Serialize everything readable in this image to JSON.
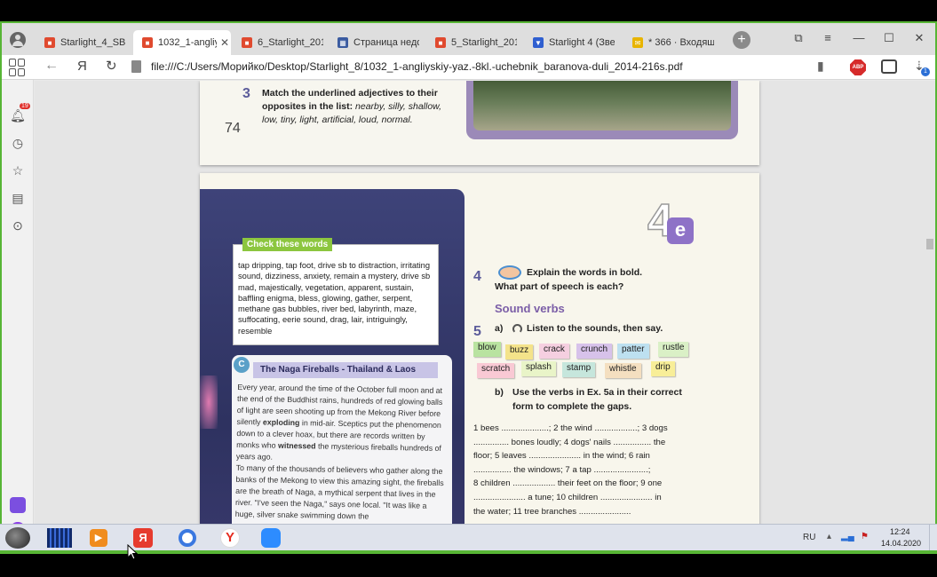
{
  "tabs": [
    {
      "label": "Starlight_4_SB.p",
      "icon": "pdf-icon",
      "active": false
    },
    {
      "label": "1032_1-angliy",
      "icon": "pdf-icon",
      "active": true
    },
    {
      "label": "6_Starlight_2013",
      "icon": "pdf-icon",
      "active": false
    },
    {
      "label": "Страница недос",
      "icon": "page-icon",
      "active": false
    },
    {
      "label": "5_Starlight_2012",
      "icon": "pdf-icon",
      "active": false
    },
    {
      "label": "Starlight 4 (Звез",
      "icon": "bookmark-icon",
      "active": false
    },
    {
      "label": "* 366 · Входящи",
      "icon": "mail-icon",
      "active": false
    }
  ],
  "address": {
    "url": "file:///C:/Users/Морийко/Desktop/Starlight_8/1032_1-angliyskiy-yaz.-8kl.-uchebnik_baranova-duli_2014-216s.pdf",
    "yandex_label": "Я"
  },
  "sidebar": {
    "notification_count": "19"
  },
  "extensions": {
    "abp": "ABP",
    "download_badge": "1"
  },
  "page74": {
    "exercise_number": "3",
    "instruction_bold": "Match the underlined adjectives to their opposites in the list:",
    "list_items": "nearby, silly, shallow, low, tiny, light, artificial, loud, normal.",
    "page_number": "74"
  },
  "page75": {
    "badge_number": "4",
    "badge_letter": "e",
    "check_words_title": "Check these words",
    "check_words_text": "tap dripping, tap foot, drive sb to distraction, irritating sound, dizziness, anxiety, remain a mystery, drive sb mad, majestically, vegetation, apparent, sustain, baffling enigma, bless, glowing, gather, serpent, methane gas bubbles, river bed, labyrinth, maze, suffocating, eerie sound, drag, lair, intriguingly, resemble",
    "reading_letter": "C",
    "reading_title": "The Naga Fireballs - Thailand & Laos",
    "reading_p1_a": "Every year, around the time of the October full moon and at the end of the Buddhist rains, hundreds of red glowing balls of light are seen shooting up from the Mekong River before silently",
    "reading_p1_bold1": "exploding",
    "reading_p1_b": "in mid-air. Sceptics put the phenomenon down to a clever hoax, but there are records written by monks who",
    "reading_p1_bold2": "witnessed",
    "reading_p1_c": "the mysterious fireballs hundreds of years ago.",
    "reading_p2": "To many of the thousands of believers who gather along the banks of the Mekong to view this amazing sight, the fireballs are the breath of Naga, a mythical serpent that lives in the river. \"I've seen the Naga,\" says one local. \"It was like a huge, silver snake swimming down the",
    "ex4_number": "4",
    "ex4_line1": "Explain the words in bold.",
    "ex4_line2": "What part of speech is each?",
    "section_title": "Sound verbs",
    "ex5_number": "5",
    "ex5a_label": "a)",
    "ex5a_text": "Listen to the sounds, then say.",
    "chips_row1": [
      "blow",
      "buzz",
      "crack",
      "crunch",
      "patter",
      "rustle"
    ],
    "chips_row2": [
      "scratch",
      "splash",
      "stamp",
      "whistle",
      "drip"
    ],
    "ex5b_label": "b)",
    "ex5b_line1": "Use the verbs in Ex. 5a in their correct",
    "ex5b_line2": "form to complete the gaps.",
    "gaps_lines": [
      "1 bees ....................; 2 the wind ..................; 3 dogs",
      "............... bones loudly; 4 dogs' nails ................ the",
      "floor; 5 leaves ...................... in the wind; 6 rain",
      "................ the windows; 7 a tap .......................;",
      "8 children .................. their feet on the floor; 9 one",
      "...................... a tune; 10 children ...................... in",
      "the water; 11 tree branches ......................"
    ]
  },
  "taskbar": {
    "lang": "RU",
    "time": "12:24",
    "date": "14.04.2020"
  },
  "colors": {
    "accent_green": "#57b535",
    "purple_heading": "#7b5ea7",
    "dark_panel": "#3a3f74"
  }
}
